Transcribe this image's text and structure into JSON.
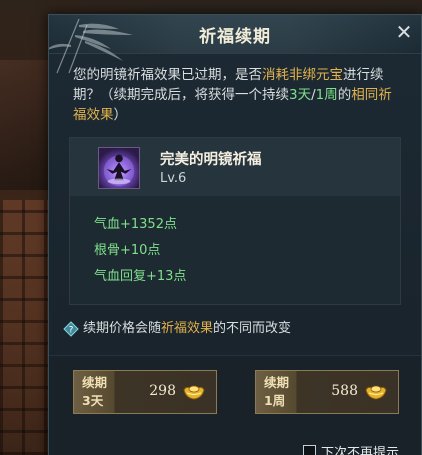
{
  "dialog": {
    "title": "祈福续期",
    "close_symbol": "✕"
  },
  "description": {
    "part1": "您的明镜祈福效果已过期，是否",
    "highlight_cost": "消耗非绑元宝",
    "part2": "进行续期？（续期完成后，将获得一个持续",
    "highlight_3days": "3天",
    "slash": "/",
    "highlight_1week": "1周",
    "part3": "的",
    "highlight_same": "相同祈福效果",
    "part4": "）"
  },
  "item": {
    "name": "完美的明镜祈福",
    "level": "Lv.6",
    "icon": "meditating-figure-icon",
    "stats": [
      "气血+1352点",
      "根骨+10点",
      "气血回复+13点"
    ]
  },
  "hint": {
    "prefix": "续期价格会随",
    "highlight": "祈福效果",
    "suffix": "的不同而改变",
    "icon": "question-diamond-icon"
  },
  "options": [
    {
      "label_line1": "续期",
      "label_line2": "3天",
      "price": "298",
      "currency_icon": "gold-ingot-icon"
    },
    {
      "label_line1": "续期",
      "label_line2": "1周",
      "price": "588",
      "currency_icon": "gold-ingot-icon"
    }
  ],
  "dont_remind": {
    "label": "下次不再提示",
    "checked": false
  },
  "colors": {
    "gold_highlight": "#e0b14c",
    "green_highlight": "#7ee08a"
  }
}
